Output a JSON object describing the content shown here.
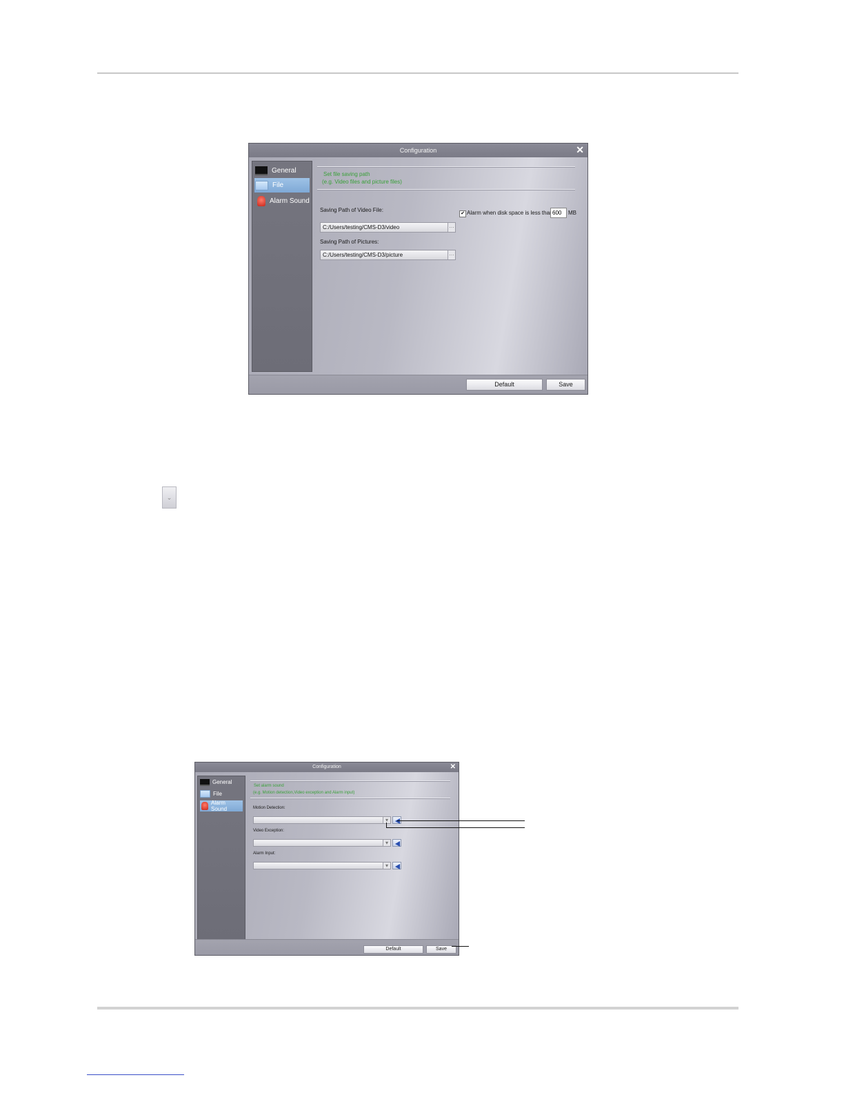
{
  "dialog_file": {
    "title": "Configuration",
    "nav": [
      {
        "label": "General",
        "icon": "monitor-icon"
      },
      {
        "label": "File",
        "icon": "folder-icon",
        "active": true
      },
      {
        "label": "Alarm Sound",
        "icon": "alarm-icon"
      }
    ],
    "hint_line1": "Set file saving path",
    "hint_line2": "(e.g. Video files and picture files)",
    "video_label": "Saving Path of Video File:",
    "video_path": "C:/Users/testing/CMS-D3/video",
    "pictures_label": "Saving Path of Pictures:",
    "pictures_path": "C:/Users/testing/CMS-D3/picture",
    "alarm_check_label": "Alarm when disk space is less than",
    "alarm_checked": true,
    "alarm_value": "600",
    "alarm_unit": "MB",
    "default_label": "Default",
    "save_label": "Save"
  },
  "dialog_alarm": {
    "title": "Configuration",
    "nav": [
      {
        "label": "General",
        "icon": "monitor-icon"
      },
      {
        "label": "File",
        "icon": "folder-icon"
      },
      {
        "label": "Alarm Sound",
        "icon": "alarm-icon",
        "active": true
      }
    ],
    "hint_line1": "Set alarm sound",
    "hint_line2": "(e.g. Motion detection,Video exception and Alarm input)",
    "motion_label": "Motion Detection:",
    "video_exception_label": "Video Exception:",
    "alarm_input_label": "Alarm Input:",
    "default_label": "Default",
    "save_label": "Save"
  }
}
